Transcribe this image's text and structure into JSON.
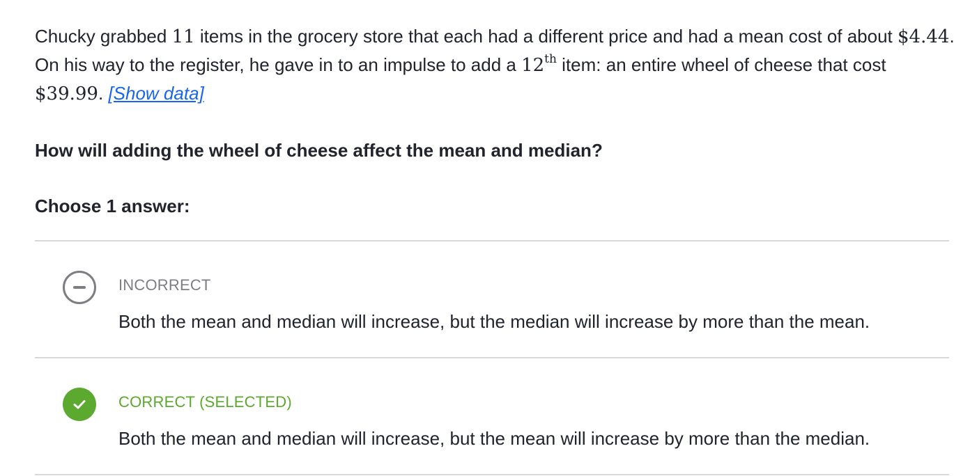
{
  "problem": {
    "part1": "Chucky grabbed ",
    "count": "11",
    "part2": " items in the grocery store that each had a different price and had a mean cost of about ",
    "mean": "$4.44",
    "part3": ". On his way to the register, he gave in to an impulse to add a ",
    "ordinal_num": "12",
    "ordinal_sup": "th",
    "part4": " item: an entire wheel of cheese that cost ",
    "cheese_price": "$39.99",
    "part5": ". ",
    "show_data_link": "[Show data]"
  },
  "question": "How will adding the wheel of cheese affect the mean and median?",
  "choose_prompt": "Choose 1 answer:",
  "choices": [
    {
      "status": "INCORRECT",
      "text": "Both the mean and median will increase, but the median will increase by more than the mean.",
      "indicator_icon": "minus-circle-icon",
      "color": "#7c7e82"
    },
    {
      "status": "CORRECT (SELECTED)",
      "text": "Both the mean and median will increase, but the mean will increase by more than the median.",
      "indicator_icon": "check-circle-icon",
      "color": "#5ba92e"
    }
  ],
  "colors": {
    "text": "#21242c",
    "link": "#1865f2",
    "divider": "#d6d8da"
  }
}
